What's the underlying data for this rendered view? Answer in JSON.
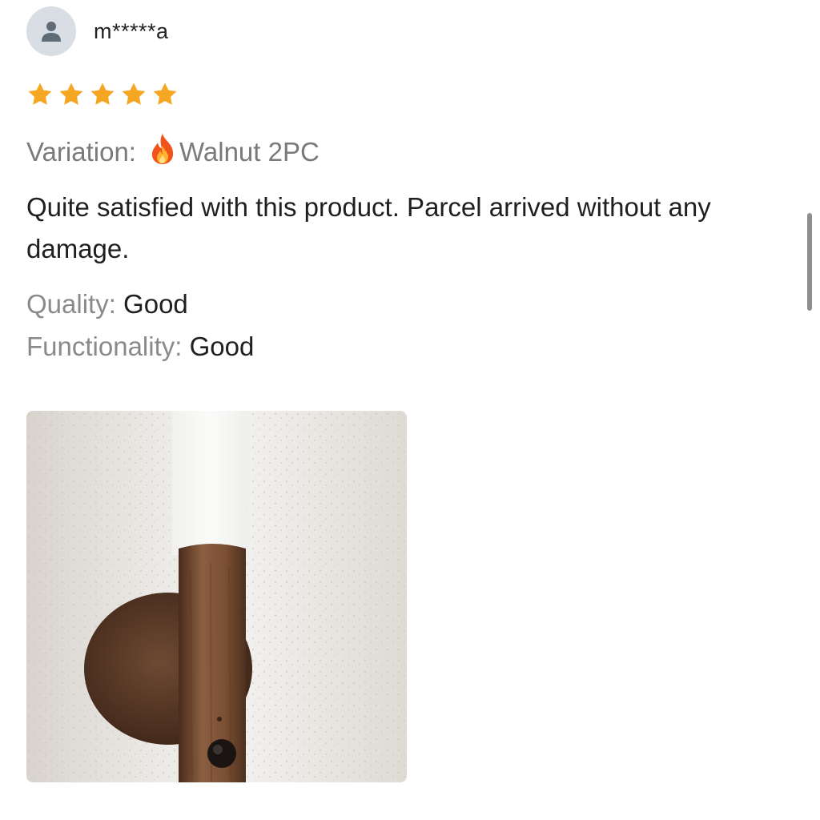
{
  "reviewer": {
    "name": "m*****a",
    "avatar_icon": "person-icon"
  },
  "rating": {
    "stars": 5,
    "max": 5,
    "color": "#f5a623"
  },
  "variation": {
    "label": "Variation:",
    "icon": "fire-icon",
    "value": "Walnut 2PC"
  },
  "review": {
    "text": "Quite satisfied with this product. Parcel arrived without any damage."
  },
  "attributes": [
    {
      "label": "Quality:",
      "value": "Good"
    },
    {
      "label": "Functionality:",
      "value": "Good"
    }
  ],
  "photo": {
    "subject": "walnut wall lamp"
  }
}
